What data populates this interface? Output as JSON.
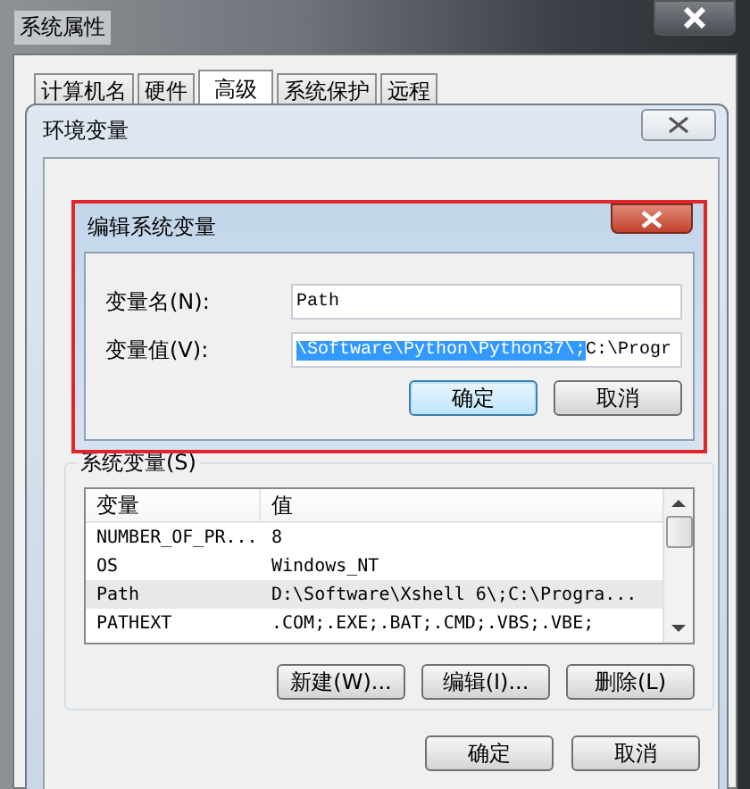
{
  "window": {
    "title": "系统属性"
  },
  "tabs": [
    {
      "label": "计算机名",
      "selected": false
    },
    {
      "label": "硬件",
      "selected": false
    },
    {
      "label": "高级",
      "selected": true
    },
    {
      "label": "系统保护",
      "selected": false
    },
    {
      "label": "远程",
      "selected": false
    }
  ],
  "env_window": {
    "title": "环境变量"
  },
  "edit_dialog": {
    "title": "编辑系统变量",
    "fields": [
      {
        "label": "变量名(N):",
        "value_parts": [
          {
            "text": "Path",
            "selected": false
          }
        ]
      },
      {
        "label": "变量值(V):",
        "value_parts": [
          {
            "text": "\\Software\\Python\\Python37\\;",
            "selected": true
          },
          {
            "text": "C:\\Progr",
            "selected": false
          }
        ]
      }
    ],
    "buttons": [
      {
        "label": "确定",
        "focused": true
      },
      {
        "label": "取消",
        "focused": false
      }
    ]
  },
  "system_variables": {
    "title": "系统变量(S)",
    "columns": [
      "变量",
      "值"
    ],
    "rows": [
      {
        "cells": [
          "NUMBER_OF_PR...",
          "8"
        ],
        "selected": false
      },
      {
        "cells": [
          "OS",
          "Windows_NT"
        ],
        "selected": false
      },
      {
        "cells": [
          "Path",
          "D:\\Software\\Xshell 6\\;C:\\Progra..."
        ],
        "selected": true
      },
      {
        "cells": [
          "PATHEXT",
          ".COM;.EXE;.BAT;.CMD;.VBS;.VBE;"
        ],
        "selected": false
      }
    ],
    "buttons": [
      "新建(W)...",
      "编辑(I)...",
      "删除(L)"
    ]
  },
  "dialog_buttons": [
    "确定",
    "取消"
  ]
}
